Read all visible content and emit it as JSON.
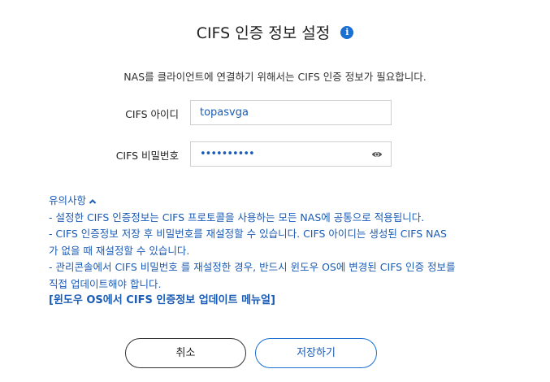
{
  "dialog": {
    "title": "CIFS 인증 정보 설정",
    "info_icon": "i",
    "description": "NAS를 클라이언트에 연결하기 위해서는 CIFS 인증 정보가 필요합니다."
  },
  "form": {
    "id_label": "CIFS 아이디",
    "id_value": "topasvga",
    "password_label": "CIFS 비밀번호",
    "password_value": "••••••••••"
  },
  "notes": {
    "title": "유의사항",
    "lines": [
      "- 설정한 CIFS 인증정보는 CIFS 프로토콜을 사용하는 모든 NAS에 공통으로 적용됩니다.",
      "- CIFS 인증정보 저장 후 비밀번호를 재설정할 수 있습니다. CIFS 아이디는 생성된 CIFS NAS가 없을 때 재설정할 수 있습니다.",
      "- 관리콘솔에서 CIFS 비밀번호 를 재설정한 경우, 반드시 윈도우 OS에 변경된 CIFS 인증 정보를 직접 업데이트해야 합니다."
    ],
    "manual_link": "[윈도우 OS에서 CIFS 인증정보 업데이트 메뉴얼]"
  },
  "buttons": {
    "cancel": "취소",
    "save": "저장하기"
  },
  "colors": {
    "accent": "#1a6fd1",
    "text_blue": "#1a5bb5"
  },
  "icons": {
    "info": "info-icon",
    "password_toggle": "eye-icon",
    "collapse": "chevron-up-icon"
  }
}
